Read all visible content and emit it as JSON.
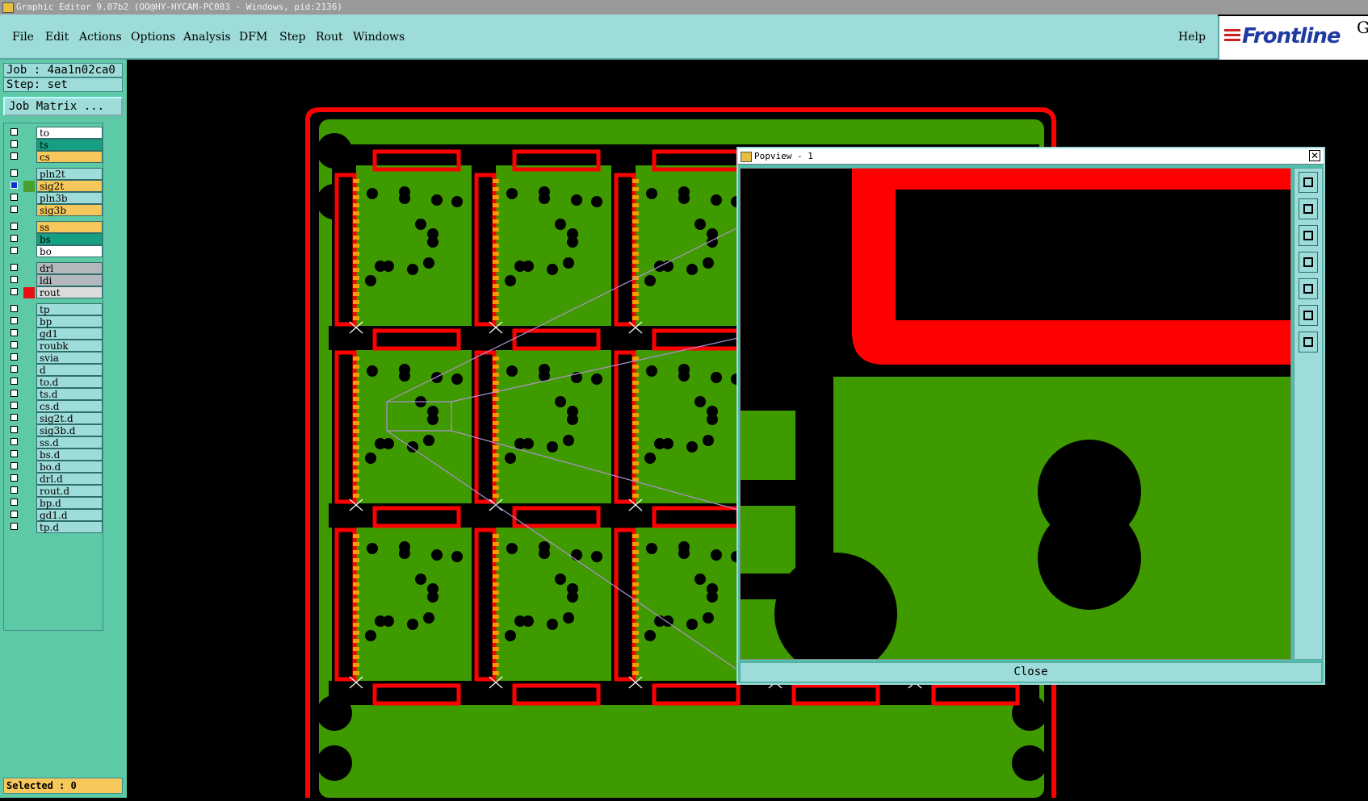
{
  "window": {
    "title": "Graphic Editor 9.07b2 (OO@HY-HYCAM-PC083 - Windows, pid:2136)"
  },
  "menu": {
    "items": [
      "File",
      "Edit",
      "Actions",
      "Options",
      "Analysis",
      "DFM",
      "Step",
      "Rout",
      "Windows"
    ],
    "help": "Help"
  },
  "logo": {
    "brand": "Frontline",
    "suffix": "G"
  },
  "job": {
    "job_line": "Job : 4aa1n02ca0",
    "step_line": "Step: set",
    "matrix_button": "Job Matrix ..."
  },
  "layers": [
    {
      "name": "to",
      "color": "#ffffff",
      "mark": ""
    },
    {
      "name": "ts",
      "color": "#16a083",
      "mark": ""
    },
    {
      "name": "cs",
      "color": "#f6c85c",
      "mark": ""
    },
    {
      "name": "pln2t",
      "color": "#9ddcd8",
      "mark": ""
    },
    {
      "name": "sig2t",
      "color": "#f6c85c",
      "mark": "#4aa02c",
      "active": true
    },
    {
      "name": "pln3b",
      "color": "#9ddcd8",
      "mark": ""
    },
    {
      "name": "sig3b",
      "color": "#f6c85c",
      "mark": ""
    },
    {
      "name": "ss",
      "color": "#f6c85c",
      "mark": ""
    },
    {
      "name": "bs",
      "color": "#16a083",
      "mark": ""
    },
    {
      "name": "bo",
      "color": "#ffffff",
      "mark": ""
    },
    {
      "name": "drl",
      "color": "#b4b8bc",
      "mark": ""
    },
    {
      "name": "ldi",
      "color": "#b4b8bc",
      "mark": ""
    },
    {
      "name": "rout",
      "color": "#dcdcdc",
      "mark": "#e81010"
    },
    {
      "name": "tp",
      "color": "#9ddcd8",
      "mark": ""
    },
    {
      "name": "bp",
      "color": "#9ddcd8",
      "mark": ""
    },
    {
      "name": "gd1",
      "color": "#9ddcd8",
      "mark": ""
    },
    {
      "name": "roubk",
      "color": "#9ddcd8",
      "mark": ""
    },
    {
      "name": "svia",
      "color": "#9ddcd8",
      "mark": ""
    },
    {
      "name": "d",
      "color": "#9ddcd8",
      "mark": ""
    },
    {
      "name": "to.d",
      "color": "#9ddcd8",
      "mark": ""
    },
    {
      "name": "ts.d",
      "color": "#9ddcd8",
      "mark": ""
    },
    {
      "name": "cs.d",
      "color": "#9ddcd8",
      "mark": ""
    },
    {
      "name": "sig2t.d",
      "color": "#9ddcd8",
      "mark": ""
    },
    {
      "name": "sig3b.d",
      "color": "#9ddcd8",
      "mark": ""
    },
    {
      "name": "ss.d",
      "color": "#9ddcd8",
      "mark": ""
    },
    {
      "name": "bs.d",
      "color": "#9ddcd8",
      "mark": ""
    },
    {
      "name": "bo.d",
      "color": "#9ddcd8",
      "mark": ""
    },
    {
      "name": "drl.d",
      "color": "#9ddcd8",
      "mark": ""
    },
    {
      "name": "rout.d",
      "color": "#9ddcd8",
      "mark": ""
    },
    {
      "name": "bp.d",
      "color": "#9ddcd8",
      "mark": ""
    },
    {
      "name": "gd1.d",
      "color": "#9ddcd8",
      "mark": ""
    },
    {
      "name": "tp.d",
      "color": "#9ddcd8",
      "mark": ""
    }
  ],
  "status": {
    "selected": "Selected : 0"
  },
  "popview": {
    "title": "Popview - 1",
    "close_label": "Close",
    "close_x": "✕"
  },
  "colors": {
    "board": "#3f9a00",
    "rout": "#ff0000",
    "background": "#000000",
    "panel": "#5ec9a6",
    "menubar": "#9ddcd8"
  }
}
